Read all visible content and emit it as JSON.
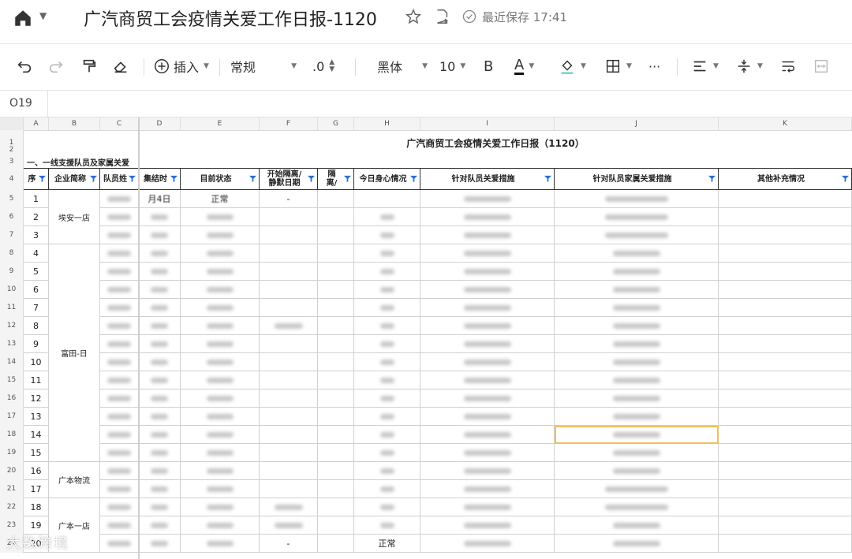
{
  "titlebar": {
    "doc_title": "广汽商贸工会疫情关爱工作日报-1120",
    "save_status": "最近保存 17:41"
  },
  "toolbar": {
    "insert_label": "插入",
    "format_label": "常规",
    "decimal_label": ".0",
    "font_label": "黑体",
    "size_label": "10",
    "bold_label": "B",
    "fontcolor_label": "A",
    "more_label": "···"
  },
  "formula": {
    "cell_ref": "O19"
  },
  "columns": [
    {
      "letter": "A"
    },
    {
      "letter": "B"
    },
    {
      "letter": "C"
    },
    {
      "letter": "D"
    },
    {
      "letter": "E"
    },
    {
      "letter": "F"
    },
    {
      "letter": "G"
    },
    {
      "letter": "H"
    },
    {
      "letter": "I"
    },
    {
      "letter": "J"
    },
    {
      "letter": "K"
    }
  ],
  "sheet": {
    "title": "广汽商贸工会疫情关爱工作日报（1120）",
    "section": "一、一线支援队员及家属关爱",
    "headers": [
      "序号",
      "企业简称",
      "队员姓名",
      "集结时间",
      "目前状态",
      "开始隔离/静默日期",
      "隔离",
      "今日身心情况",
      "针对队员关爱措施",
      "针对队员家属关爱措施",
      "其他补充情况"
    ],
    "header_visible": [
      "序",
      "企业简称",
      "队员姓",
      "集结时",
      "目前状态",
      "开始隔离/\n静默日期",
      "隔\n离/",
      "今日身心情况",
      "针对队员关爱措施",
      "针对队员家属关爱措施",
      "其他补充情况"
    ],
    "rows": [
      {
        "n": "5",
        "seq": "1"
      },
      {
        "n": "6",
        "seq": "2"
      },
      {
        "n": "7",
        "seq": "3"
      },
      {
        "n": "8",
        "seq": "4"
      },
      {
        "n": "9",
        "seq": "5"
      },
      {
        "n": "10",
        "seq": "6"
      },
      {
        "n": "11",
        "seq": "7"
      },
      {
        "n": "12",
        "seq": "8"
      },
      {
        "n": "13",
        "seq": "9"
      },
      {
        "n": "14",
        "seq": "10"
      },
      {
        "n": "15",
        "seq": "11"
      },
      {
        "n": "16",
        "seq": "12"
      },
      {
        "n": "17",
        "seq": "13"
      },
      {
        "n": "18",
        "seq": "14"
      },
      {
        "n": "19",
        "seq": "15"
      },
      {
        "n": "20",
        "seq": "16"
      },
      {
        "n": "21",
        "seq": "17"
      },
      {
        "n": "22",
        "seq": "18"
      },
      {
        "n": "23",
        "seq": "19"
      },
      {
        "n": "24",
        "seq": "20"
      }
    ],
    "companies": [
      "埃安一店",
      "富田-日",
      "广本物流",
      "广本一店"
    ],
    "visible_values": {
      "r5_d": "月4日",
      "r5_e": "正常",
      "r5_f": "-",
      "r24_f": "-",
      "r24_h": "正常"
    }
  },
  "watermark": "大数跨境",
  "colors": {
    "selection": "#f0c060",
    "accent": "#1a73e8"
  }
}
